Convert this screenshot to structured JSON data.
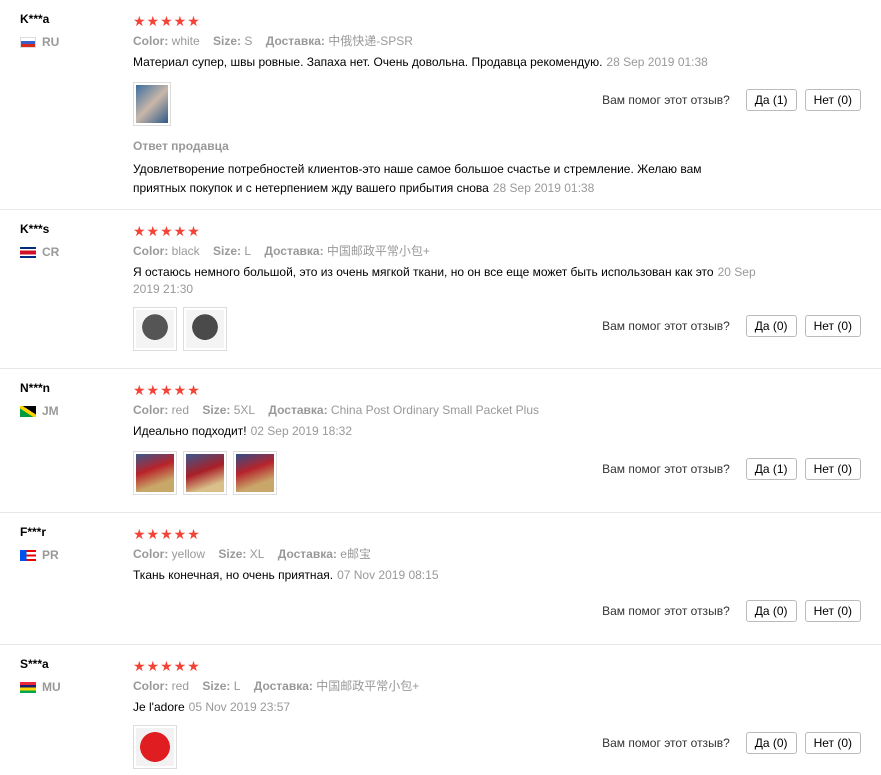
{
  "helpful_question": "Вам помог этот отзыв?",
  "color_label": "Color:",
  "size_label": "Size:",
  "delivery_label": "Доставка:",
  "seller_reply_title": "Ответ продавца",
  "reviews": [
    {
      "name": "K***a",
      "country": "RU",
      "stars": "★★★★★",
      "color": "white",
      "size": "S",
      "delivery": "中俄快递-SPSR",
      "text": "Материал супер, швы ровные. Запаха нет. Очень довольна. Продавца рекомендую.",
      "date": "28 Sep 2019 01:38",
      "yes": "Да (1)",
      "no": "Нет (0)",
      "reply_text": "Удовлетворение потребностей клиентов-это наше самое большое счастье и стремление. Желаю вам приятных покупок и с нетерпением жду вашего прибытия снова",
      "reply_date": "28 Sep 2019 01:38"
    },
    {
      "name": "K***s",
      "country": "CR",
      "stars": "★★★★★",
      "color": "black",
      "size": "L",
      "delivery": "中国邮政平常小包+",
      "text": "Я остаюсь немного большой, это из очень мягкой ткани, но он все еще может быть использован как это",
      "date": "20 Sep 2019 21:30",
      "yes": "Да (0)",
      "no": "Нет (0)"
    },
    {
      "name": "N***n",
      "country": "JM",
      "stars": "★★★★★",
      "color": "red",
      "size": "5XL",
      "delivery": "China Post Ordinary Small Packet Plus",
      "text": "Идеально подходит!",
      "date": "02 Sep 2019 18:32",
      "yes": "Да (1)",
      "no": "Нет (0)"
    },
    {
      "name": "F***r",
      "country": "PR",
      "stars": "★★★★★",
      "color": "yellow",
      "size": "XL",
      "delivery": "e邮宝",
      "text": "Ткань конечная, но очень приятная.",
      "date": "07 Nov 2019 08:15",
      "yes": "Да (0)",
      "no": "Нет (0)"
    },
    {
      "name": "S***a",
      "country": "MU",
      "stars": "★★★★★",
      "color": "red",
      "size": "L",
      "delivery": "中国邮政平常小包+",
      "text": "Je l'adore",
      "date": "05 Nov 2019 23:57",
      "yes": "Да (0)",
      "no": "Нет (0)"
    }
  ]
}
